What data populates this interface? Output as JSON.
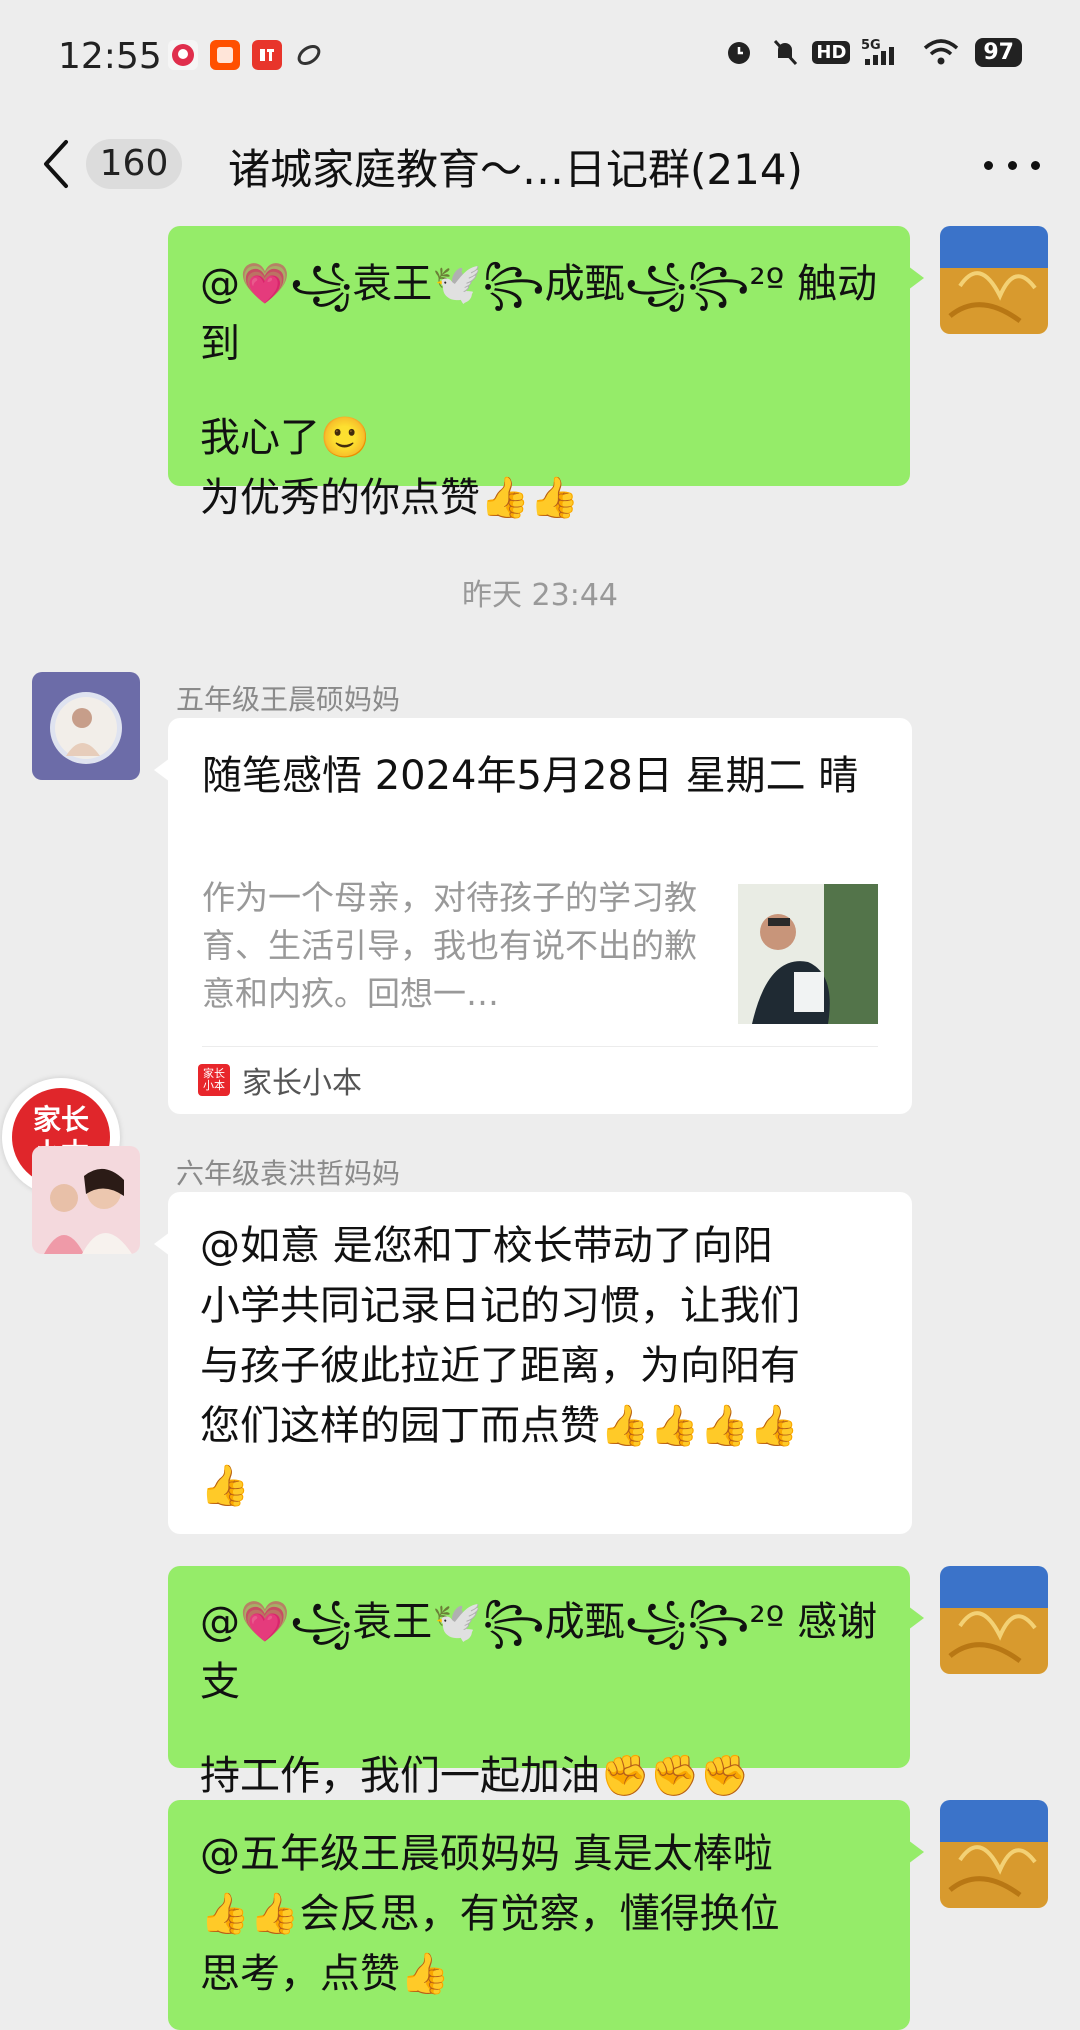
{
  "status_bar": {
    "time": "12:55",
    "notification_icons": [
      "pinduoduo-icon",
      "taobao-icon",
      "ting-icon",
      "swirl-icon"
    ],
    "status_icons": [
      "alarm-icon",
      "mute-icon",
      "hd-icon",
      "5g-signal-icon",
      "wifi-icon"
    ],
    "hd_label": "HD",
    "network_label": "5G",
    "battery": "97"
  },
  "header": {
    "unread_count": "160",
    "title": "诸城家庭教育～…日记群(214)"
  },
  "messages": {
    "m1": {
      "line1": "@💗꧁袁王🕊️꧂成甄꧁꧂²º 触动到",
      "line2": "我心了🙂",
      "line3": "为优秀的你点赞👍👍"
    },
    "timestamp": "昨天 23:44",
    "m2": {
      "sender": "五年级王晨硕妈妈",
      "card_title": "随笔感悟   2024年5月28日  星期二   晴",
      "card_desc": "作为一个母亲，对待孩子的学习教育、生活引导，我也有说不出的歉意和内疚。回想一…",
      "source_name": "家长小本"
    },
    "m3": {
      "sender": "六年级袁洪哲妈妈",
      "line1": "@如意  是您和丁校长带动了向阳",
      "line2": "小学共同记录日记的习惯，让我们",
      "line3": "与孩子彼此拉近了距离，为向阳有",
      "line4": "您们这样的园丁而点赞👍👍👍👍",
      "line5": "👍"
    },
    "m4": {
      "line1": "@💗꧁袁王🕊️꧂成甄꧁꧂²º 感谢支",
      "line2": "持工作，我们一起加油✊✊✊"
    },
    "m5": {
      "line1": "@五年级王晨硕妈妈  真是太棒啦",
      "line2": "👍👍会反思，有觉察，懂得换位",
      "line3": "思考，点赞👍"
    }
  },
  "floating_badge": {
    "line1": "家长",
    "line2": "小本"
  },
  "source_icon_text": "家长小本",
  "colors": {
    "outgoing_bubble": "#95ec69",
    "incoming_bubble": "#ffffff",
    "background": "#ededed",
    "brand_red": "#e0262b"
  }
}
